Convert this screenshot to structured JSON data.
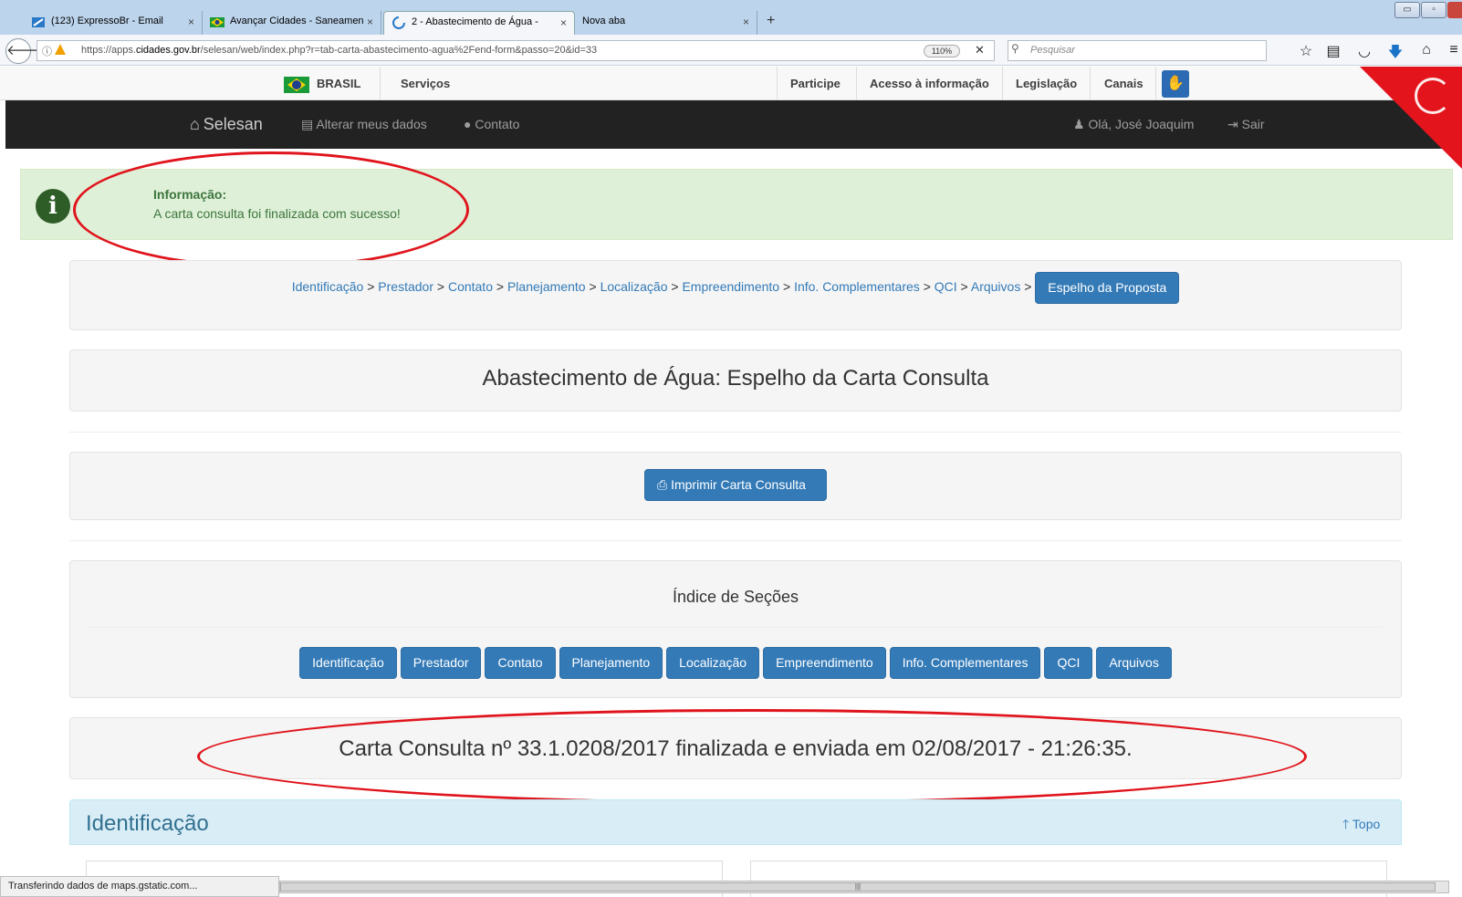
{
  "browser": {
    "tabs": [
      {
        "label": "(123) ExpressoBr - Email",
        "close": "×"
      },
      {
        "label": "Avançar Cidades - Saneamen",
        "close": "×"
      },
      {
        "label": "2 - Abastecimento de Água - ",
        "close": "×"
      },
      {
        "label": "Nova aba",
        "close": "×"
      }
    ],
    "new_tab": "+",
    "url_domain_prefix": "https://apps.",
    "url_domain": "cidades.gov.br",
    "url_rest": "/selesan/web/index.php?r=tab-carta-abastecimento-agua%2Fend-form&passo=20&id=33",
    "zoom": "110%",
    "stop": "✕",
    "search_placeholder": "Pesquisar",
    "status_text": "Transferindo dados de maps.gstatic.com...",
    "scroll_grip": "|||"
  },
  "govbar": {
    "brasil": "BRASIL",
    "servicos": "Serviços",
    "participe": "Participe",
    "acesso": "Acesso à informação",
    "legislacao": "Legislação",
    "canais": "Canais"
  },
  "appnav": {
    "brand": "Selesan",
    "alterar": "Alterar meus dados",
    "contato": "Contato",
    "user": "Olá, José Joaquim",
    "sair": "Sair"
  },
  "alert": {
    "title": "Informação:",
    "message": "A carta consulta foi finalizada com sucesso!"
  },
  "breadcrumb": {
    "items": [
      "Identificação",
      "Prestador",
      "Contato",
      "Planejamento",
      "Localização",
      "Empreendimento",
      "Info. Complementares",
      "QCI",
      "Arquivos"
    ],
    "separator": ">",
    "active": "Espelho da Proposta"
  },
  "page_title": "Abastecimento de Água: Espelho da Carta Consulta",
  "print_button": "Imprimir Carta Consulta",
  "index": {
    "title": "Índice de Seções",
    "buttons": [
      "Identificação",
      "Prestador",
      "Contato",
      "Planejamento",
      "Localização",
      "Empreendimento",
      "Info. Complementares",
      "QCI",
      "Arquivos"
    ]
  },
  "submission_text": "Carta Consulta nº 33.1.0208/2017 finalizada e enviada em 02/08/2017 - 21:26:35.",
  "section": {
    "title": "Identificação",
    "topo": "Topo"
  },
  "colors": {
    "primary": "#337ab7",
    "success_bg": "#dff0d8",
    "navbar": "#222222",
    "annotation": "#e0141c"
  }
}
